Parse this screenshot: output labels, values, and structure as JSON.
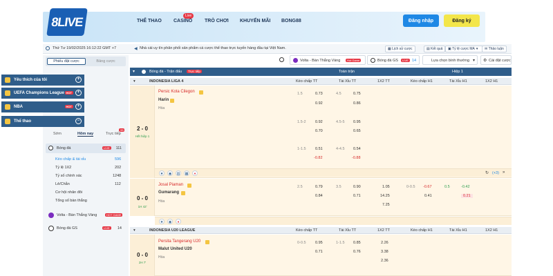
{
  "header": {
    "logo": "8LIVE",
    "nav": [
      "THỂ THAO",
      "CASINO",
      "TRÒ CHƠI",
      "KHUYẾN MÃI",
      "BONG88"
    ],
    "live_badge": "Live",
    "login": "Đăng nhập",
    "register": "Đăng ký"
  },
  "infobar": {
    "datetime": "Thứ Tư 19/02/2025 16:12:22 GMT +7",
    "notice": "Nhà cái uy tín phân phối sản phẩm cá cược thể thao trực tuyến hàng đầu tại Việt Nam.",
    "history": "Lịch sử cược",
    "results": "Kết quả",
    "odds_type": "Tỷ lệ cược MA",
    "forum": "Thảo luận"
  },
  "sidebar": {
    "tab_slip": "Phiếu đặt cược",
    "tab_board": "Bảng cược",
    "favorites": "Yêu thích của tôi",
    "ucl": "UEFA Champions League",
    "nba": "NBA",
    "sports": "Thể thao",
    "tabs": [
      "Sớm",
      "Hôm nay",
      "Trực tiếp"
    ],
    "live_count": "33",
    "football": "Bóng đá",
    "football_badge": "LIVE",
    "football_count": "111",
    "items": [
      {
        "label": "Kèo chấp & tài xỉu",
        "count": "596"
      },
      {
        "label": "Tỷ lệ 1X2",
        "count": "202"
      },
      {
        "label": "Tỷ số chính xác",
        "count": "1248"
      },
      {
        "label": "Lẻ/Chẵn",
        "count": "112"
      },
      {
        "label": "Cơ hội nhân đôi",
        "count": ""
      },
      {
        "label": "Tổng số bàn thắng",
        "count": ""
      }
    ],
    "volta": "Volta - Bàn Thắng Vàng",
    "volta_badge": "HOT GAME",
    "gs": "Bóng đá GS",
    "gs_badge": "LIVE",
    "gs_count": "14"
  },
  "toolbar": {
    "volta": "Volta - Bàn Thắng Vàng",
    "volta_badge": "Hot Game",
    "gs": "Bóng đá GS",
    "gs_badge": "LIVE",
    "gs_count": "14",
    "sort": "Lựa chọn bình thường",
    "settings": "Cài đặt cược"
  },
  "table": {
    "head_left": "Bóng đá - Trận đấu",
    "head_badge": "Trực tiếp",
    "fulltime": "Toàn trận",
    "half1": "Hiệp 1",
    "cols": [
      "Kèo chấp TT",
      "Tài Xỉu TT",
      "1X2 TT",
      "Kèo chấp H1",
      "Tài Xỉu H1",
      "1X2 H1"
    ]
  },
  "leagues": [
    {
      "name": "INDONESIA LIGA 4"
    },
    {
      "name": "INDONESIA U20 LEAGUE"
    }
  ],
  "match1": {
    "home": "Persic Kota Cilegon",
    "away": "Harin",
    "draw": "Hòa",
    "score": "2 - 0",
    "period": "Hết hiệp 1",
    "rows": [
      {
        "hc": "1.5",
        "hc_home": "0.73",
        "hc_away": "0.92",
        "ou": "4.5",
        "ou_over": "0.75",
        "ou_under": "0.86"
      },
      {
        "hc": "1.5-2",
        "hc_home": "0.92",
        "hc_away": "0.70",
        "ou": "4.5-5",
        "ou_over": "0.95",
        "ou_under": "0.65"
      },
      {
        "hc": "1-1.5",
        "hc_home": "0.51",
        "hc_away": "-0.82",
        "ou": "4-4.5",
        "ou_over": "0.54",
        "ou_under": "-0.88"
      }
    ],
    "more": "(+3)"
  },
  "match2": {
    "home": "Josal Piaman",
    "away": "Gumarang",
    "draw": "Hòa",
    "score": "0 - 0",
    "period": "1H 42'",
    "hc": "2.5",
    "hc_home": "0.79",
    "hc_away": "0.84",
    "ou": "3.5",
    "ou_over": "0.90",
    "ou_under": "0.71",
    "x12": [
      "1.05",
      "14.25",
      "7.25"
    ],
    "h1_hc": "0-0.5",
    "h1_hc_home": "-0.67",
    "h1_hc_away": "0.41",
    "h1_ou": "0.5",
    "h1_ou_over": "-0.42",
    "h1_ou_under": "0.21"
  },
  "match3": {
    "home": "Persita Tangerang U20",
    "away": "Malut United U20",
    "draw": "Hòa",
    "score": "0 - 0",
    "period": "2H 7'",
    "hc": "0-0.5",
    "hc_home": "0.95",
    "hc_away": "0.71",
    "ou": "1-1.5",
    "ou_over": "0.85",
    "ou_under": "0.76",
    "x12": [
      "2.26",
      "3.38",
      "2.36"
    ]
  }
}
